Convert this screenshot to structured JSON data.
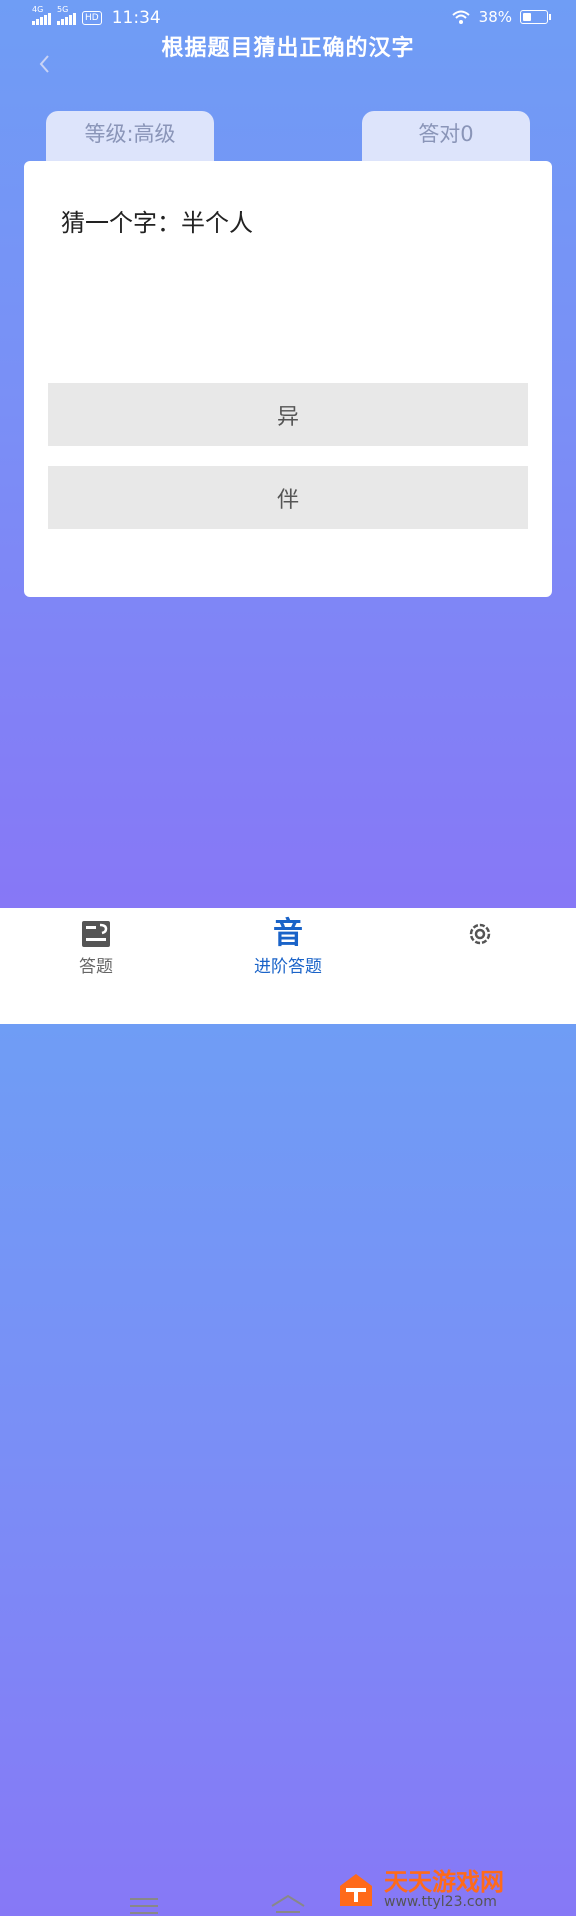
{
  "status_bar": {
    "net1": "4G",
    "net2": "5G",
    "hd": "HD",
    "time": "11:34",
    "battery": "38%"
  },
  "header": {
    "title": "根据题目猜出正确的汉字"
  },
  "tabs": {
    "level": "等级:高级",
    "score": "答对0"
  },
  "quiz": {
    "question": "猜一个字：半个人",
    "options": [
      "异",
      "伴"
    ]
  },
  "bottom_nav": {
    "items": [
      {
        "label": "答题",
        "icon": "quiz-icon"
      },
      {
        "label": "进阶答题",
        "icon_text": "音"
      },
      {
        "label": "",
        "icon": "gear-icon"
      }
    ]
  },
  "watermark": {
    "brand": "天天游戏网",
    "url": "www.ttyl23.com"
  },
  "colors": {
    "accent": "#1a63c8",
    "watermark": "#ff6a1a"
  }
}
